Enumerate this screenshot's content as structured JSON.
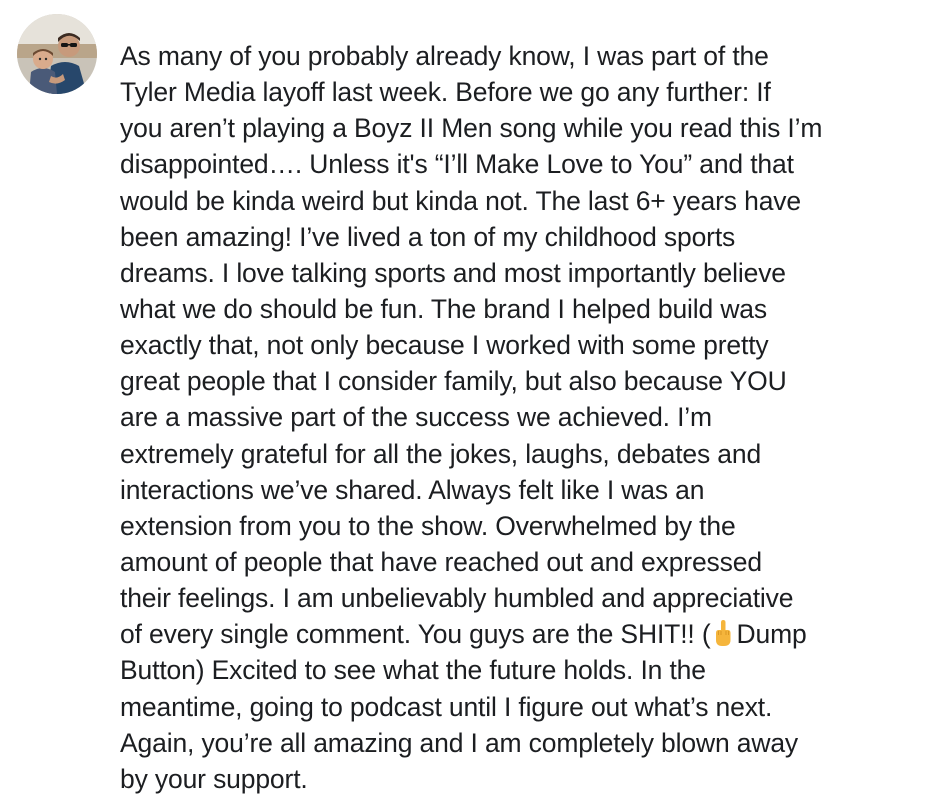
{
  "post": {
    "author_avatar": "profile photo of man in sunglasses holding a child",
    "emoji_icon": "middle-finger-emoji",
    "lines": [
      "As many of you probably already know, I was part of the",
      "Tyler Media layoff last week. Before we go any further: If",
      "you aren’t playing a Boyz II Men song while you read this I’m",
      "disappointed…. Unless it's “I’ll Make Love to You” and that",
      "would be kinda weird but kinda not. The last 6+ years have",
      "been amazing! I’ve lived a ton of my childhood sports",
      "dreams. I love talking sports and most importantly believe",
      "what we do should be fun. The brand I helped build was",
      "exactly that, not only because I worked with some pretty",
      "great people that I consider family, but also because YOU",
      "are a massive part of the success we achieved. I’m",
      "extremely grateful for all the jokes, laughs, debates and",
      "interactions we’ve shared. Always felt like I was an",
      "extension from you to the show. Overwhelmed by the",
      "amount of people that have reached out and expressed",
      "their feelings. I am unbelievably humbled and appreciative",
      "of every single comment. You guys are the SHIT!! (",
      "Button) Excited to see what the future holds. In the",
      "meantime, going to podcast until I figure out what’s next.",
      "Again, you’re all amazing and I am completely blown away",
      "by your support."
    ],
    "line_17_after_emoji": "Dump"
  }
}
